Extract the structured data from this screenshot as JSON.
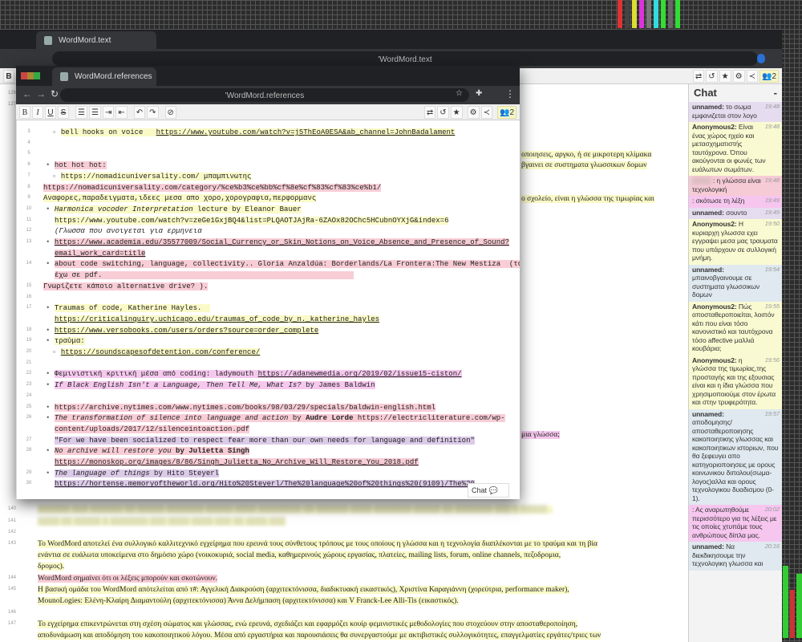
{
  "colors": {
    "highlight_yellow": "#fafac8",
    "highlight_pink": "#f8cdd6",
    "highlight_magenta": "#f6c8ee",
    "highlight_violet": "#dccbe8",
    "highlight_blue": "#dfe9ef"
  },
  "back_window": {
    "tab_title": "WordMord.text",
    "url": "'WordMord.text",
    "toolbar": {
      "bold": "B",
      "users_count": "2"
    },
    "fragments": [
      {
        "text": "οποιησεις, αργκο, ή σε μικροτερη κλίμακα",
        "hl": "y"
      },
      {
        "text": "βγαινει σε συστηματα γλωσσικων δομων",
        "hl": "y"
      },
      {
        "text": "ο σχολείο, είναι η γλώσσα της τιμωρίας και",
        "hl": "y"
      },
      {
        "text": "μια γλώσσα;",
        "hl": "m"
      }
    ],
    "lines": [
      {
        "num": "126",
        "text": ""
      },
      {
        "num": "127",
        "text": ""
      },
      {
        "num": "140",
        "text": "▒▒▒▒▒▒ ▒▒▒ ▒▒▒▒▒▒ ▒▒ ▒▒▒▒▒ ▒▒▒▒▒▒▒ ▒▒▒▒▒ ▒▒▒▒ ▒▒▒▒▒▒▒▒ ▒▒ ▒▒▒▒▒▒ ▒▒▒▒ ▒▒▒▒▒▒▒ ▒▒▒▒▒ ▒▒ ▒▒▒▒▒▒▒ ▒▒▒ ▒ ▒▒▒▒▒ ..",
        "hl": "y",
        "blur": true
      },
      {
        "num": "141",
        "text": "▒▒▒▒ ▒▒ ▒▒▒▒▒ ▒ ▒▒▒▒▒▒▒ ▒▒▒ ▒▒▒▒ ▒▒▒▒ ▒▒▒ ▒▒ ▒▒▒▒ ▒▒▒",
        "hl": "y",
        "blur": true
      },
      {
        "num": "142",
        "text": ""
      },
      {
        "num": "143",
        "text": "Το WordMord αποτελεί ένα συλλογικό καλλιτεχνικό εγχείρημα που ερευνά τους σύνθετους τρόπους με τους οποίους η γλώσσα και η τεχνολογία διαπλέκονται με το τραύμα και τη βία",
        "hl": "y"
      },
      {
        "num": "",
        "text": "ενάντια σε ευάλωτα υποκείμενα στο δημόσιο χώρο (νοικοκυριά, social media, καθημερινούς χώρους εργασίας, πλατείες, mailing lists, forum, online channels, πεζοδρομια,",
        "hl": "y"
      },
      {
        "num": "",
        "text": "δρομος).",
        "hl": "y"
      },
      {
        "num": "144",
        "text": "WordMord σημαίνει ότι οι λέξεις μπορούν και σκοτώνουν.",
        "hl": "p"
      },
      {
        "num": "145",
        "text": "Η βασική ομάδα του WordMord απότελείται από τ#: Αγγελική Διακρούση (αρχιτεκτόνισσα, διαδικτυακή εικαστικός), Χριστίνα Καραγιάννη (χορεύτρια, performance maker),",
        "hl": "y"
      },
      {
        "num": "",
        "text": "MounoLogies: Ελένη-Κλαίρη Διαμαντούλη (αρχιτεκτόνισσα) Άννα Δελήμπαση (αρχιτεκτόνισσα) και V Franck-Lee Alli-Tis (εικαστικός).",
        "hl": "y"
      },
      {
        "num": "146",
        "text": ""
      },
      {
        "num": "147",
        "text": "Το εγχείρημα επικεντρώνεται στη σχέση σώματος και γλώσσας, ενώ ερευνά, σχεδιάζει και εφαρμόζει κουίρ φεμινιστικές μεθοδολογίες που στοχεύουν στην αποσταθεροποίηση,",
        "hl": "y"
      },
      {
        "num": "",
        "text": "αποδυνάμωση και αποδόμηση του κακοποιητικού λόγου. Μέσα από εργαστήρια και παρουσιάσεις θα συνεργαστούμε με ακτιβιστικές συλλογικότητες, επαγγελματίες εργάτες/τριες των",
        "hl": "y"
      }
    ]
  },
  "chat": {
    "title": "Chat",
    "collapse": "-",
    "messages": [
      {
        "author": "unnamed:",
        "text": "το σωμα εμφανιζεται στον λογο",
        "time": "19:48",
        "bg": "#e6dcef"
      },
      {
        "author": "Anonymous2:",
        "text": "Είναι ένας χώρος ηχείο και μετασχηματιστής ταυτόχρονα. Όπου ακούγονται οι φωνές των ευάλωτων σωμάτων.",
        "time": "19:48",
        "bg": "#fafad2"
      },
      {
        "author": "▒▒▒▒",
        "text": ": η γλώσσα είναι τεχνολογική",
        "time": "19:48",
        "bg": "#f6cbd6",
        "blur": true
      },
      {
        "author": "",
        "text": ": σκότωσε τη λέξη",
        "time": "19:49",
        "bg": "#f6c6ef"
      },
      {
        "author": "unnamed:",
        "text": "σουντο",
        "time": "19:49",
        "bg": "#e6dcef"
      },
      {
        "author": "Anonymous2:",
        "text": "Η κυριαρχη γλωσσα εχει εγγραψει μεσα μας τραυματα που υπάρχουν σε συλλογική μνήμη.",
        "time": "19:50",
        "bg": "#fafad2"
      },
      {
        "author": "unnamed:",
        "text": "μπαινοβγαινουμε σε συστηματα γλωσσικων δομων",
        "time": "19:54",
        "bg": "#dfe9ef"
      },
      {
        "author": "Anonymous2:",
        "text": "Πώς αποσταθεροποιείται, λοιπόν κάτι που είναι τόσο κανονιστικό και ταυτόχρονα τόσο affective μαλλιά κουβάρια;",
        "time": "19:55",
        "bg": "#fafad2"
      },
      {
        "author": "Anonymous2:",
        "text": "η γλώσσα της τιμωρίας,της προσταγής και της εξουσιας είναι και η ίδια γλώσσα που χρησιμοποιούμε στον έρωτα και στην τρυφερότητα.",
        "time": "19:56",
        "bg": "#fafad2"
      },
      {
        "author": "unnamed:",
        "text": "αποδομησης/ αποσταθεροποιησης κακοποιητικης γλωσσας και κακοποιητικων ιστοριων, που θα ξεφευγει απο κατηγοριοποιησεις με ορους κοινωνικου διπολου(σωμα-λογος)αλλα και ορους τεχνολογικου δυαδισμου (0-1).",
        "time": "19:57",
        "bg": "#dfe9ef"
      },
      {
        "author": "",
        "text": ": Ας αναρωτηθούμε περισσότερο για τις λέξεις με τις οποίες χτυπάμε τους ανθρώπους δίπλα μας.",
        "time": "20:02",
        "bg": "#f6c6ef"
      },
      {
        "author": "unnamed:",
        "text": "Να διεκδικησουμε την τεχνολογικη γλωσσα και",
        "time": "20:16",
        "bg": "#dfe9ef"
      }
    ]
  },
  "front_window": {
    "tab_title": "WordMord.references",
    "url": "'WordMord.references",
    "toolbar": {
      "bold": "B",
      "italic": "I",
      "underline": "U",
      "strike": "S",
      "users_count": "2"
    },
    "chat_button": "Chat",
    "lines": [
      {
        "num": "3",
        "ind": 2,
        "bul": "▫",
        "segs": [
          {
            "t": "bell hooks on voice   ",
            "hl": "y"
          },
          {
            "t": "https://www.youtube.com/watch?v=j5ThEoA0ESA&ab_channel=JohnBadalament",
            "hl": "y",
            "s": "u"
          }
        ]
      },
      {
        "num": "4",
        "segs": []
      },
      {
        "num": "5",
        "segs": []
      },
      {
        "num": "6",
        "ind": 0,
        "bul": "•",
        "segs": [
          {
            "t": "hot hot hot:",
            "hl": "p"
          }
        ]
      },
      {
        "num": "7",
        "ind": 2,
        "bul": "▫",
        "segs": [
          {
            "t": "https://nomadicuniversality.com/ μπαμπινωτης",
            "hl": "y"
          }
        ]
      },
      {
        "num": "8",
        "ind": -1,
        "segs": [
          {
            "t": "https://nomadicuniversality.com/category/%ce%b3%ce%bb%cf%8e%cf%83%cf%83%ce%b1/",
            "hl": "p"
          }
        ]
      },
      {
        "num": "9",
        "ind": -1,
        "segs": [
          {
            "t": "Αναφορες,παραδειγματα,ιδεες μεσα απο χορο,χορογραφια,περφορμανς",
            "hl": "y"
          }
        ]
      },
      {
        "num": "10",
        "ind": 0,
        "bul": "•",
        "segs": [
          {
            "t": "Harmonica vocoder Interpretation",
            "hl": "y",
            "s": "i"
          },
          {
            "t": " lecture by Eleanor Bauer",
            "hl": "y"
          }
        ]
      },
      {
        "num": "11",
        "ind": 1,
        "segs": [
          {
            "t": "https://www.youtube.com/watch?v=zeGe1GxjBQ4&list=PLQAOTJAjRa-6ZAOx82OChc5HCubnOYXjG&index=6",
            "hl": "y"
          }
        ]
      },
      {
        "num": "12",
        "ind": 1,
        "segs": [
          {
            "t": "(Γλωσσα που ανοιγεται για ερμηνεια",
            "hl": "",
            "s": "i"
          }
        ]
      },
      {
        "num": "13",
        "ind": 0,
        "bul": "•",
        "segs": [
          {
            "t": "https://www.academia.edu/35577009/Social_Currency_or_Skin_Notions_on_Voice_Absence_and_Presence_of_Sound?",
            "hl": "p",
            "s": "u"
          }
        ]
      },
      {
        "num": "",
        "ind": 1,
        "segs": [
          {
            "t": "email_work_card=title",
            "hl": "p",
            "s": "u"
          }
        ]
      },
      {
        "num": "14",
        "ind": 0,
        "bul": "•",
        "segs": [
          {
            "t": "about code switching, language, collectivity.. Gloria Anzaldúa: Borderlands/La Frontera:The New Mestiza  (το",
            "hl": "p"
          }
        ]
      },
      {
        "num": "",
        "ind": 1,
        "segs": [
          {
            "t": "έχω σε pdf.                                                          ",
            "hl": "p"
          }
        ]
      },
      {
        "num": "15",
        "ind": -1,
        "segs": [
          {
            "t": "Γνωρίζετε κάποιο alternative drive? ).",
            "hl": "p"
          }
        ]
      },
      {
        "num": "16",
        "segs": []
      },
      {
        "num": "17",
        "ind": 0,
        "bul": "•",
        "segs": [
          {
            "t": "Traumas of code, Katherine Hayles.  ",
            "hl": "y"
          }
        ]
      },
      {
        "num": "",
        "ind": 1,
        "segs": [
          {
            "t": "https://criticalinquiry.uchicago.edu/traumas_of_code_by_n._katherine_hayles",
            "hl": "y",
            "s": "u"
          }
        ]
      },
      {
        "num": "18",
        "ind": 0,
        "bul": "•",
        "segs": [
          {
            "t": "https://www.versobooks.com/users/orders?source=order_complete",
            "hl": "y",
            "s": "u"
          }
        ]
      },
      {
        "num": "19",
        "ind": 0,
        "bul": "•",
        "segs": [
          {
            "t": "τραύμα:",
            "hl": "y"
          }
        ]
      },
      {
        "num": "20",
        "ind": 2,
        "bul": "▫",
        "segs": [
          {
            "t": "https://soundscapesofdetention.com/conference/",
            "hl": "y",
            "s": "u"
          }
        ]
      },
      {
        "num": "21",
        "segs": []
      },
      {
        "num": "22",
        "ind": 0,
        "bul": "•",
        "segs": [
          {
            "t": "Φεμινιστική κριτική μέσα από coding: ladymouth ",
            "hl": "m"
          },
          {
            "t": "https://adanewmedia.org/2019/02/issue15-ciston/",
            "hl": "m",
            "s": "u"
          }
        ]
      },
      {
        "num": "23",
        "ind": 0,
        "bul": "•",
        "segs": [
          {
            "t": "If Black English Isn't a Language, Then Tell Me, What Is?",
            "hl": "m",
            "s": "i"
          },
          {
            "t": " by James Baldwin",
            "hl": "m"
          }
        ]
      },
      {
        "num": "24",
        "segs": []
      },
      {
        "num": "25",
        "ind": 0,
        "bul": "•",
        "segs": [
          {
            "t": "https://archive.nytimes.com/www.nytimes.com/books/98/03/29/specials/baldwin-english.html",
            "hl": "p"
          }
        ]
      },
      {
        "num": "26",
        "ind": 0,
        "bul": "•",
        "segs": [
          {
            "t": "The transformation of silence into language and action",
            "hl": "p",
            "s": "i"
          },
          {
            "t": " by ",
            "hl": "p"
          },
          {
            "t": "Audre Lorde",
            "hl": "p",
            "s": "bo"
          },
          {
            "t": " https://electricliterature.com/wp-",
            "hl": "p"
          }
        ]
      },
      {
        "num": "",
        "ind": 1,
        "segs": [
          {
            "t": "content/uploads/2017/12/silenceintoaction.pdf",
            "hl": "p"
          }
        ]
      },
      {
        "num": "27",
        "ind": 1,
        "segs": [
          {
            "t": "\"For we have been socialized to respect fear more than our own needs for language and definition\"",
            "hl": "v"
          }
        ]
      },
      {
        "num": "28",
        "ind": 0,
        "bul": "•",
        "segs": [
          {
            "t": "No archive will restore you",
            "hl": "p",
            "s": "i"
          },
          {
            "t": " by Julietta Singh",
            "hl": "p",
            "s": "bo"
          }
        ]
      },
      {
        "num": "",
        "ind": 1,
        "segs": [
          {
            "t": "https://monoskop.org/images/8/86/Singh_Julietta_No_Archive_Will_Restore_You_2018.pdf",
            "hl": "p",
            "s": "u"
          }
        ]
      },
      {
        "num": "29",
        "ind": 0,
        "bul": "•",
        "segs": [
          {
            "t": "The language of things",
            "hl": "v",
            "s": "i"
          },
          {
            "t": " by Hito Steyerl",
            "hl": "v"
          }
        ]
      },
      {
        "num": "30",
        "ind": 1,
        "segs": [
          {
            "t": "https://hortense.memoryoftheworld.org/Hito%20Steyerl/The%20language%20of%20things%20(9109)/The%20",
            "hl": "v",
            "s": "u"
          }
        ]
      }
    ]
  }
}
